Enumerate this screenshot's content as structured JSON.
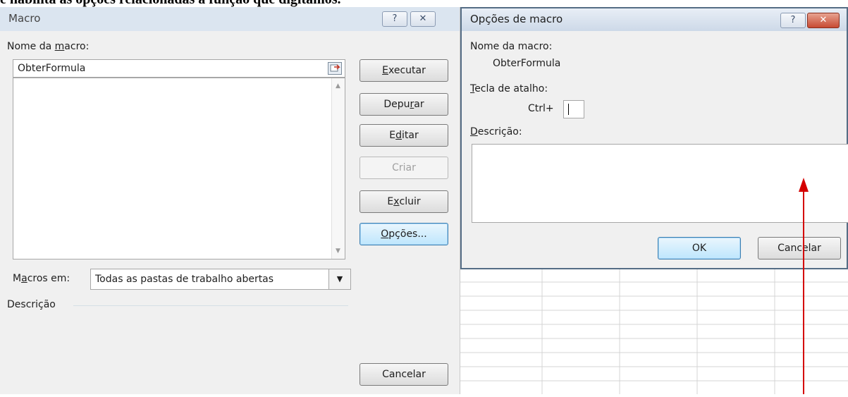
{
  "document_text": "e habilita as opções relacionadas à função que digitamos.",
  "macro_dialog": {
    "title": "Macro",
    "help_glyph": "?",
    "close_glyph": "✕",
    "name_label_pre": "Nome da ",
    "name_label_u": "m",
    "name_label_post": "acro:",
    "name_value": "ObterFormula",
    "buttons": {
      "run_pre": "",
      "run_u": "E",
      "run_post": "xecutar",
      "debug_pre": "Depu",
      "debug_u": "r",
      "debug_post": "ar",
      "edit_pre": "E",
      "edit_u": "d",
      "edit_post": "itar",
      "create": "Criar",
      "delete_pre": "E",
      "delete_u": "x",
      "delete_post": "cluir",
      "options_pre": "",
      "options_u": "O",
      "options_post": "pções...",
      "cancel": "Cancelar"
    },
    "macros_in_label_pre": "M",
    "macros_in_label_u": "a",
    "macros_in_label_post": "cros em:",
    "macros_in_value": "Todas as pastas de trabalho abertas",
    "description_label": "Descrição"
  },
  "options_dialog": {
    "title": "Opções de macro",
    "help_glyph": "?",
    "close_glyph": "✕",
    "macro_name_label": "Nome da macro:",
    "macro_name_value": "ObterFormula",
    "shortcut_label_u": "T",
    "shortcut_label_post": "ecla de atalho:",
    "ctrl_label": "Ctrl+",
    "shortcut_value": "",
    "description_label_u": "D",
    "description_label_post": "escrição:",
    "description_value": "",
    "ok_label": "OK",
    "cancel_label": "Cancelar"
  },
  "colors": {
    "arrow": "#d40000",
    "focus_border": "#3c7fb1"
  }
}
